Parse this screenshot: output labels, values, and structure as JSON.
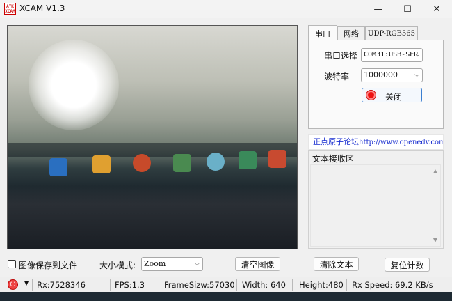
{
  "window": {
    "title": "XCAM V1.3",
    "icon_text": "ATK XCAM"
  },
  "tabs": [
    "串口",
    "网络",
    "UDP-RGB565"
  ],
  "serial": {
    "port_label": "串口选择",
    "port_value": "COM31:USB-SER",
    "baud_label": "波特率",
    "baud_value": "1000000",
    "close_label": "关闭"
  },
  "forum": {
    "label": "正点原子论坛",
    "url": "http://www.openedv.com/"
  },
  "receive": {
    "title": "文本接收区"
  },
  "controls": {
    "save_checkbox_label": "图像保存到文件",
    "size_mode_label": "大小模式:",
    "size_mode_value": "Zoom",
    "clear_image": "清空图像",
    "clear_text": "清除文本",
    "reset_count": "复位计数"
  },
  "status": {
    "rx": "Rx:7528346",
    "fps": "FPS:1.3",
    "frame_size": "FrameSizw:57030",
    "width": "Width:  640",
    "height": "Height:480",
    "rx_speed": "Rx Speed:  69.2 KB/s"
  },
  "colors": {
    "accent_blue": "#1a2fd0",
    "record_red": "#e11"
  }
}
